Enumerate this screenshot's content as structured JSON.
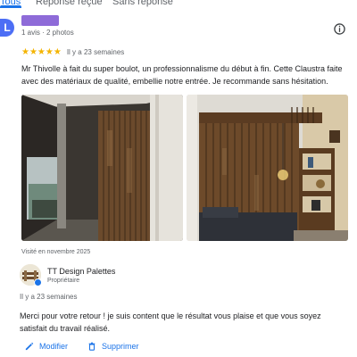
{
  "tabs": [
    {
      "label": "Tous",
      "active": true
    },
    {
      "label": "Réponse reçue",
      "active": false
    },
    {
      "label": "Sans réponse",
      "active": false
    }
  ],
  "review": {
    "avatar_letter": "L",
    "meta": "1 avis · 2 photos",
    "stars": "★★★★★",
    "rating": 5,
    "time": "Il y a 23 semaines",
    "text": "Mr Thivolle à fait du super boulot, un professionnalisme du début à fin. Cette Claustra faite avec des matériaux de qualité, embellie notre entrée. Je recommande sans hésitation.",
    "visited": "Visité en novembre 2025"
  },
  "reply": {
    "owner_name": "TT Design Palettes",
    "owner_role": "Propriétaire",
    "time": "Il y a 23 semaines",
    "text": "Merci pour votre retour ! je suis content que le résultat vous plaise et que vous soyez satisfait du travail réalisé."
  },
  "actions": {
    "edit_label": "Modifier",
    "delete_label": "Supprimer"
  },
  "icons": {
    "info": "info-icon",
    "edit": "pencil-icon",
    "delete": "trash-icon",
    "verified": "check-badge-icon"
  },
  "colors": {
    "accent": "#1a73e8",
    "star": "#f4b400",
    "avatar": "#4c6ef5",
    "redaction": "#8e6bd8"
  }
}
